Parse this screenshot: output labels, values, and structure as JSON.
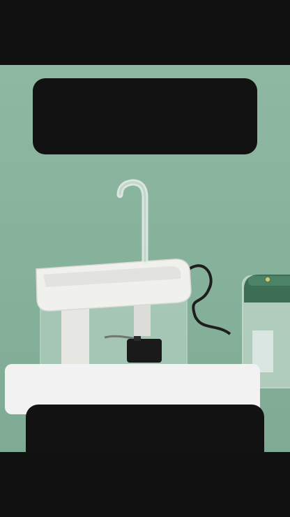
{
  "video": {
    "description_alt": "",
    "caption_text": "",
    "top_overlay_text": "",
    "bottom_overlay_text": ""
  },
  "colors": {
    "background_green": "#88b39c",
    "letterbox": "#111111",
    "caption_bg": "#f2f2f2"
  }
}
